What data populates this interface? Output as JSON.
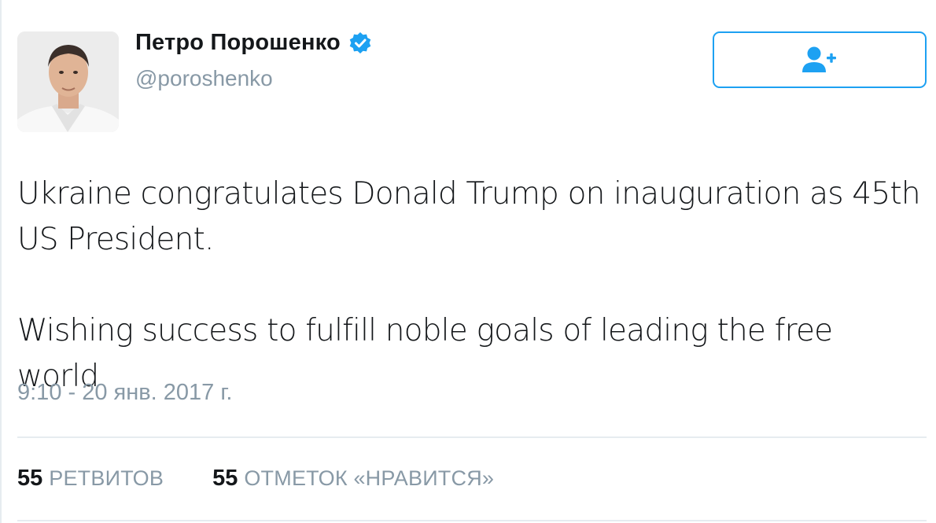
{
  "author": {
    "display_name": "Петро Порошенко",
    "handle": "@poroshenko",
    "verified_icon": "verified-badge-icon",
    "avatar_icon": "profile-photo"
  },
  "follow_button": {
    "icon": "add-user-icon"
  },
  "tweet": {
    "line1": "Ukraine congratulates Donald Trump on inauguration as 45th US President.",
    "line2": "Wishing success to fulfill noble goals of leading the free world",
    "timestamp": "9:10 - 20 янв. 2017 г."
  },
  "stats": {
    "retweets_count": "55",
    "retweets_label": "РЕТВИТОВ",
    "likes_count": "55",
    "likes_label": "ОТМЕТОК «НРАВИТСЯ»"
  },
  "colors": {
    "accent": "#1da1f2",
    "text": "#14171a",
    "muted": "#8899a6",
    "divider": "#e6ecf0"
  }
}
